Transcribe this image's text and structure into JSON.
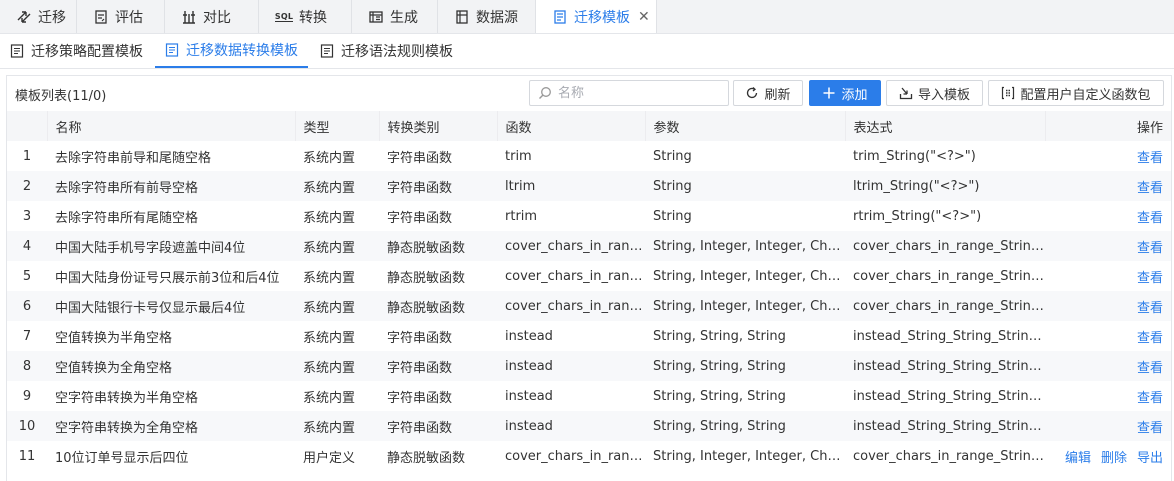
{
  "top_tabs": [
    {
      "label": "迁移",
      "icon": "migrate-icon"
    },
    {
      "label": "评估",
      "icon": "evaluate-icon"
    },
    {
      "label": "对比",
      "icon": "compare-icon"
    },
    {
      "label": "转换",
      "icon": "sql-icon"
    },
    {
      "label": "生成",
      "icon": "generate-icon"
    },
    {
      "label": "数据源",
      "icon": "datasource-icon"
    },
    {
      "label": "迁移模板",
      "icon": "template-icon"
    }
  ],
  "sql_badge": "SQL",
  "close_glyph": "✕",
  "sub_tabs": [
    {
      "label": "迁移策略配置模板"
    },
    {
      "label": "迁移数据转换模板"
    },
    {
      "label": "迁移语法规则模板"
    }
  ],
  "list": {
    "title": "模板列表(11/0)",
    "search_placeholder": "名称",
    "refresh_label": "刷新",
    "add_label": "添加",
    "import_label": "导入模板",
    "config_label": "配置用户自定义函数包"
  },
  "table": {
    "columns": [
      "名称",
      "类型",
      "转换类别",
      "函数",
      "参数",
      "表达式",
      "操作"
    ],
    "rows": [
      {
        "idx": "1",
        "name": "去除字符串前导和尾随空格",
        "type": "系统内置",
        "category": "字符串函数",
        "func": "trim",
        "params": "String",
        "expr": "trim_String(\"<?>\")",
        "ops": [
          "查看"
        ]
      },
      {
        "idx": "2",
        "name": "去除字符串所有前导空格",
        "type": "系统内置",
        "category": "字符串函数",
        "func": "ltrim",
        "params": "String",
        "expr": "ltrim_String(\"<?>\")",
        "ops": [
          "查看"
        ]
      },
      {
        "idx": "3",
        "name": "去除字符串所有尾随空格",
        "type": "系统内置",
        "category": "字符串函数",
        "func": "rtrim",
        "params": "String",
        "expr": "rtrim_String(\"<?>\")",
        "ops": [
          "查看"
        ]
      },
      {
        "idx": "4",
        "name": "中国大陆手机号字段遮盖中间4位",
        "type": "系统内置",
        "category": "静态脱敏函数",
        "func": "cover_chars_in_range",
        "params": "String, Integer, Integer, Chara…",
        "expr": "cover_chars_in_range_String…",
        "ops": [
          "查看"
        ]
      },
      {
        "idx": "5",
        "name": "中国大陆身份证号只展示前3位和后4位",
        "type": "系统内置",
        "category": "静态脱敏函数",
        "func": "cover_chars_in_range",
        "params": "String, Integer, Integer, Chara…",
        "expr": "cover_chars_in_range_String…",
        "ops": [
          "查看"
        ]
      },
      {
        "idx": "6",
        "name": "中国大陆银行卡号仅显示最后4位",
        "type": "系统内置",
        "category": "静态脱敏函数",
        "func": "cover_chars_in_range",
        "params": "String, Integer, Integer, Chara…",
        "expr": "cover_chars_in_range_String…",
        "ops": [
          "查看"
        ]
      },
      {
        "idx": "7",
        "name": "空值转换为半角空格",
        "type": "系统内置",
        "category": "字符串函数",
        "func": "instead",
        "params": "String, String, String",
        "expr": "instead_String_String_String(…",
        "ops": [
          "查看"
        ]
      },
      {
        "idx": "8",
        "name": "空值转换为全角空格",
        "type": "系统内置",
        "category": "字符串函数",
        "func": "instead",
        "params": "String, String, String",
        "expr": "instead_String_String_String(…",
        "ops": [
          "查看"
        ]
      },
      {
        "idx": "9",
        "name": "空字符串转换为半角空格",
        "type": "系统内置",
        "category": "字符串函数",
        "func": "instead",
        "params": "String, String, String",
        "expr": "instead_String_String_String(…",
        "ops": [
          "查看"
        ]
      },
      {
        "idx": "10",
        "name": "空字符串转换为全角空格",
        "type": "系统内置",
        "category": "字符串函数",
        "func": "instead",
        "params": "String, String, String",
        "expr": "instead_String_String_String(…",
        "ops": [
          "查看"
        ]
      },
      {
        "idx": "11",
        "name": "10位订单号显示后四位",
        "type": "用户定义",
        "category": "静态脱敏函数",
        "func": "cover_chars_in_range",
        "params": "String, Integer, Integer, Chara…",
        "expr": "cover_chars_in_range_String…",
        "ops": [
          "编辑",
          "删除",
          "导出"
        ]
      }
    ]
  },
  "colors": {
    "accent": "#2b7de9",
    "header_bg": "#f5f6f8",
    "tabbar_bg": "#f2f3f5"
  }
}
